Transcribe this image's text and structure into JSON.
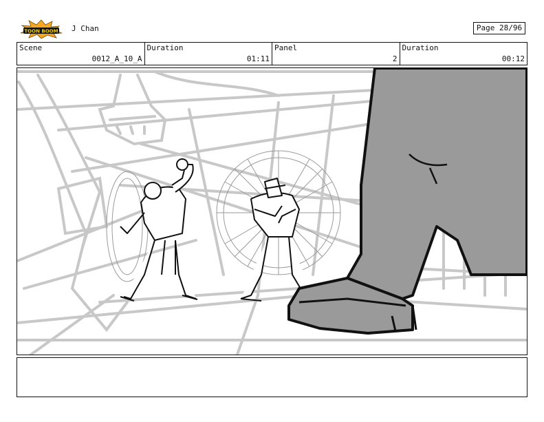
{
  "header": {
    "logo_text": "TOON BOOM",
    "author": "J Chan",
    "page": "Page 28/96"
  },
  "fields": [
    {
      "label": "Scene",
      "value": "0012_A_10_A"
    },
    {
      "label": "Duration",
      "value": "01:11"
    },
    {
      "label": "Panel",
      "value": "2"
    },
    {
      "label": "Duration",
      "value": "00:12"
    }
  ],
  "colors": {
    "logo_orange": "#f5a623",
    "sketch_grey": "#c8c8c8",
    "foot_fill": "#9a9a9a",
    "ink": "#111111"
  },
  "notes": ""
}
